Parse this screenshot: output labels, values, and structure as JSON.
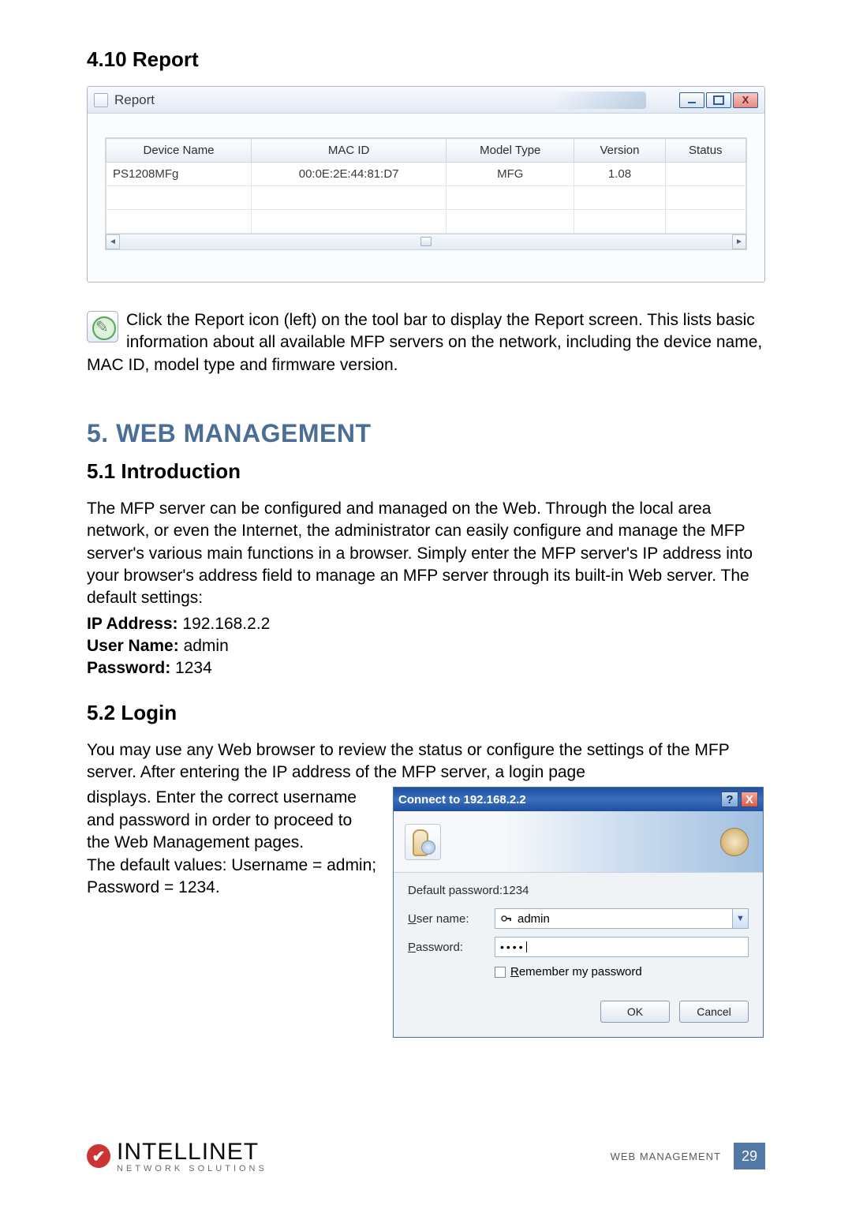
{
  "section410": {
    "title": "4.10  Report"
  },
  "report_window": {
    "title": "Report",
    "headers": [
      "Device Name",
      "MAC ID",
      "Model Type",
      "Version",
      "Status"
    ],
    "row": {
      "device_name": "PS1208MFg",
      "mac_id": "00:0E:2E:44:81:D7",
      "model_type": "MFG",
      "version": "1.08",
      "status": ""
    }
  },
  "report_para": "Click the Report icon (left) on the tool bar to display the Report screen. This lists basic information about all available MFP servers on the network, including the device name, MAC ID, model type and firmware version.",
  "chapter5": {
    "title": "5. WEB MANAGEMENT"
  },
  "section51": {
    "title": "5.1  Introduction",
    "para": "The MFP server can be configured and managed on the Web. Through the local area network, or even the Internet, the administrator can easily configure and manage the MFP server's various main functions in a browser. Simply enter the MFP server's IP address into your browser's address field to manage an MFP server through its built-in Web server. The default settings:",
    "ip_label": "IP Address:",
    "ip_value": "192.168.2.2",
    "user_label": "User Name:",
    "user_value": "admin",
    "pw_label": "Password:",
    "pw_value": "1234"
  },
  "section52": {
    "title": "5.2  Login",
    "para_top": "You may use any Web browser to review the status or configure the settings of the MFP server. After entering the IP address of the MFP server, a login page",
    "para_left": "displays. Enter the correct username and password in order to proceed to the Web Management pages.\nThe default values: Username = admin; Password = 1234."
  },
  "login_dialog": {
    "title": "Connect to 192.168.2.2",
    "hint": "Default password:1234",
    "user_label_pre": "U",
    "user_label_post": "ser name:",
    "user_value": "admin",
    "pw_label_pre": "P",
    "pw_label_post": "assword:",
    "pw_value": "••••",
    "remember_pre": "R",
    "remember_post": "emember my password",
    "ok": "OK",
    "cancel": "Cancel"
  },
  "footer": {
    "brand": "INTELLINET",
    "tag": "NETWORK SOLUTIONS",
    "section": "WEB MANAGEMENT",
    "page": "29"
  }
}
